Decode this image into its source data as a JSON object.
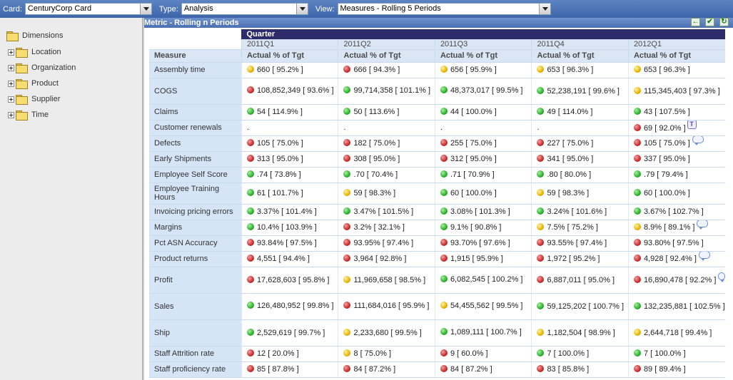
{
  "toolbar": {
    "card_label": "Card:",
    "card_value": "CenturyCorp Card",
    "type_label": "Type:",
    "type_value": "Analysis",
    "view_label": "View:",
    "view_value": "Measures - Rolling 5 Periods"
  },
  "sidebar": {
    "root": "Dimensions",
    "items": [
      {
        "label": "Location"
      },
      {
        "label": "Organization"
      },
      {
        "label": "Product"
      },
      {
        "label": "Supplier"
      },
      {
        "label": "Time"
      }
    ]
  },
  "panel": {
    "title": "Metric - Rolling n Periods",
    "buttons": [
      "back-arrow-icon",
      "checkmark-icon",
      "refresh-icon"
    ]
  },
  "grid": {
    "group_header": "Quarter",
    "measure_header": "Measure",
    "periods": [
      "2011Q1",
      "2011Q2",
      "2011Q3",
      "2011Q4",
      "2012Q1"
    ],
    "column_label": "Actual % of Tgt",
    "status_colors": {
      "red": "#c92b2b",
      "yellow": "#e8b400",
      "green": "#2bb02b"
    },
    "rows": [
      {
        "measure": "Assembly time",
        "cells": [
          {
            "s": "yellow",
            "v": "660 [ 95.2% ]"
          },
          {
            "s": "red",
            "v": "666 [ 94.3% ]"
          },
          {
            "s": "yellow",
            "v": "656 [ 95.9% ]"
          },
          {
            "s": "yellow",
            "v": "653 [ 96.3% ]"
          },
          {
            "s": "yellow",
            "v": "653 [ 96.3% ]"
          }
        ]
      },
      {
        "measure": "COGS",
        "cells": [
          {
            "s": "red",
            "v": "108,852,349 [ 93.6% ]",
            "wrap": true
          },
          {
            "s": "green",
            "v": "99,714,358 [ 101.1% ]",
            "wrap": true
          },
          {
            "s": "green",
            "v": "48,373,017 [ 99.5% ]",
            "wrap": true
          },
          {
            "s": "green",
            "v": "52,238,191 [ 99.6% ]"
          },
          {
            "s": "yellow",
            "v": "115,345,403 [ 97.3% ]"
          }
        ]
      },
      {
        "measure": "Claims",
        "cells": [
          {
            "s": "green",
            "v": "54 [ 114.9% ]"
          },
          {
            "s": "green",
            "v": "50 [ 113.6% ]"
          },
          {
            "s": "green",
            "v": "44 [ 100.0% ]"
          },
          {
            "s": "green",
            "v": "49 [ 114.0% ]"
          },
          {
            "s": "green",
            "v": "43 [ 107.5% ]"
          }
        ]
      },
      {
        "measure": "Customer renewals",
        "cells": [
          {
            "s": "",
            "v": "."
          },
          {
            "s": "",
            "v": "."
          },
          {
            "s": "",
            "v": "."
          },
          {
            "s": "",
            "v": "."
          },
          {
            "s": "red",
            "v": "69 [ 92.0% ]",
            "icon": "T"
          }
        ]
      },
      {
        "measure": "Defects",
        "cells": [
          {
            "s": "red",
            "v": "105 [ 75.0% ]"
          },
          {
            "s": "red",
            "v": "182 [ 75.0% ]"
          },
          {
            "s": "red",
            "v": "255 [ 75.0% ]"
          },
          {
            "s": "red",
            "v": "227 [ 75.0% ]"
          },
          {
            "s": "red",
            "v": "105 [ 75.0% ]",
            "icon": "comment"
          }
        ]
      },
      {
        "measure": "Early Shipments",
        "cells": [
          {
            "s": "red",
            "v": "313 [ 95.0% ]"
          },
          {
            "s": "red",
            "v": "308 [ 95.0% ]"
          },
          {
            "s": "red",
            "v": "312 [ 95.0% ]"
          },
          {
            "s": "red",
            "v": "341 [ 95.0% ]"
          },
          {
            "s": "red",
            "v": "337 [ 95.0% ]"
          }
        ]
      },
      {
        "measure": "Employee Self Score",
        "cells": [
          {
            "s": "green",
            "v": ".74 [ 73.8% ]"
          },
          {
            "s": "green",
            "v": ".70 [ 70.4% ]"
          },
          {
            "s": "green",
            "v": ".71 [ 70.9% ]"
          },
          {
            "s": "green",
            "v": ".80 [ 80.0% ]"
          },
          {
            "s": "green",
            "v": ".79 [ 79.4% ]"
          }
        ]
      },
      {
        "measure": "Employee Training Hours",
        "cells": [
          {
            "s": "green",
            "v": "61 [ 101.7% ]"
          },
          {
            "s": "yellow",
            "v": "59 [ 98.3% ]"
          },
          {
            "s": "green",
            "v": "60 [ 100.0% ]"
          },
          {
            "s": "yellow",
            "v": "59 [ 98.3% ]"
          },
          {
            "s": "green",
            "v": "60 [ 100.0% ]"
          }
        ]
      },
      {
        "measure": "Invoicing pricing errors",
        "cells": [
          {
            "s": "green",
            "v": "3.37% [ 101.4% ]"
          },
          {
            "s": "green",
            "v": "3.47% [ 101.5% ]"
          },
          {
            "s": "green",
            "v": "3.08% [ 101.3% ]"
          },
          {
            "s": "green",
            "v": "3.24% [ 101.6% ]"
          },
          {
            "s": "green",
            "v": "3.67% [ 102.7% ]"
          }
        ]
      },
      {
        "measure": "Margins",
        "cells": [
          {
            "s": "green",
            "v": "10.4% [ 103.9% ]"
          },
          {
            "s": "red",
            "v": "3.2% [ 32.1% ]"
          },
          {
            "s": "green",
            "v": "9.1% [ 90.8% ]"
          },
          {
            "s": "yellow",
            "v": "7.5% [ 75.2% ]"
          },
          {
            "s": "yellow",
            "v": "8.9% [ 89.1% ]",
            "icon": "comment"
          }
        ]
      },
      {
        "measure": "Pct ASN Accuracy",
        "cells": [
          {
            "s": "red",
            "v": "93.84% [ 97.5% ]"
          },
          {
            "s": "red",
            "v": "93.95% [ 97.4% ]"
          },
          {
            "s": "red",
            "v": "93.70% [ 97.6% ]"
          },
          {
            "s": "red",
            "v": "93.55% [ 97.4% ]"
          },
          {
            "s": "red",
            "v": "93.80% [ 97.5% ]"
          }
        ]
      },
      {
        "measure": "Product returns",
        "cells": [
          {
            "s": "red",
            "v": "4,551 [ 94.4% ]"
          },
          {
            "s": "red",
            "v": "3,964 [ 92.8% ]"
          },
          {
            "s": "red",
            "v": "1,915 [ 95.9% ]"
          },
          {
            "s": "red",
            "v": "1,972 [ 95.2% ]"
          },
          {
            "s": "red",
            "v": "4,928 [ 92.4% ]",
            "icon": "comment"
          }
        ]
      },
      {
        "measure": "Profit",
        "cells": [
          {
            "s": "red",
            "v": "17,628,603 [ 95.8% ]"
          },
          {
            "s": "yellow",
            "v": "11,969,658 [ 98.5% ]"
          },
          {
            "s": "green",
            "v": "6,082,545 [ 100.2% ]",
            "wrap": true
          },
          {
            "s": "red",
            "v": "6,887,011 [ 95.0% ]"
          },
          {
            "s": "red",
            "v": "16,890,478 [ 92.2% ]",
            "icon": "comment"
          }
        ]
      },
      {
        "measure": "Sales",
        "cells": [
          {
            "s": "green",
            "v": "126,480,952 [ 99.8% ]",
            "wrap": true
          },
          {
            "s": "red",
            "v": "111,684,016 [ 95.9% ]",
            "wrap": true
          },
          {
            "s": "yellow",
            "v": "54,455,562 [ 99.5% ]",
            "wrap": true
          },
          {
            "s": "green",
            "v": "59,125,202 [ 100.7% ]"
          },
          {
            "s": "green",
            "v": "132,235,881 [ 102.5% ]"
          }
        ]
      },
      {
        "measure": "Ship",
        "cells": [
          {
            "s": "green",
            "v": "2,529,619 [ 99.7% ]"
          },
          {
            "s": "yellow",
            "v": "2,233,680 [ 99.5% ]"
          },
          {
            "s": "green",
            "v": "1,089,111 [ 100.7% ]",
            "wrap": true
          },
          {
            "s": "yellow",
            "v": "1,182,504 [ 98.9% ]"
          },
          {
            "s": "yellow",
            "v": "2,644,718 [ 99.4% ]"
          }
        ]
      },
      {
        "measure": "Staff Attrition rate",
        "cells": [
          {
            "s": "red",
            "v": "12 [ 20.0% ]"
          },
          {
            "s": "yellow",
            "v": "8 [ 75.0% ]"
          },
          {
            "s": "red",
            "v": "9 [ 60.0% ]"
          },
          {
            "s": "green",
            "v": "7 [ 100.0% ]"
          },
          {
            "s": "green",
            "v": "7 [ 100.0% ]"
          }
        ]
      },
      {
        "measure": "Staff proficiency rate",
        "cells": [
          {
            "s": "red",
            "v": "85 [ 87.8% ]"
          },
          {
            "s": "red",
            "v": "84 [ 87.2% ]"
          },
          {
            "s": "red",
            "v": "84 [ 87.2% ]"
          },
          {
            "s": "red",
            "v": "83 [ 85.8% ]"
          },
          {
            "s": "red",
            "v": "89 [ 89.4% ]"
          }
        ]
      }
    ]
  }
}
